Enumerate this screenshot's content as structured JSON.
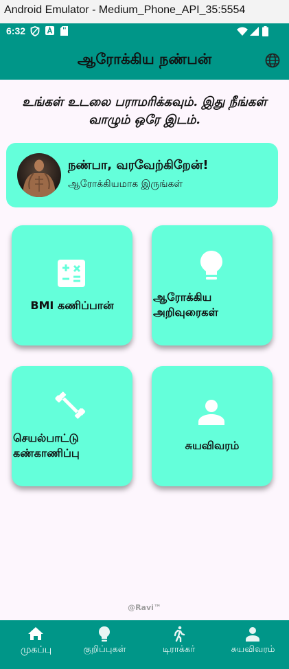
{
  "emulator": {
    "window_title": "Android Emulator - Medium_Phone_API_35:5554"
  },
  "status_bar": {
    "time": "6:32"
  },
  "app_bar": {
    "title": "ஆரோக்கிய நண்பன்",
    "action_icon": "language-globe-icon"
  },
  "tagline": "உங்கள் உடலை பராமரிக்கவும். இது நீங்கள் வாழும் ஒரே இடம்.",
  "welcome": {
    "greeting": "நண்பா, வரவேற்கிறேன்!",
    "subtitle": "ஆரோக்கியமாக இருங்கள்"
  },
  "tiles": [
    {
      "label": "BMI கணிப்பான்",
      "icon": "calculator-icon"
    },
    {
      "label": "ஆரோக்கிய அறிவுரைகள்",
      "icon": "lightbulb-icon"
    },
    {
      "label": "செயல்பாட்டு கண்காணிப்பு",
      "icon": "dumbbell-icon"
    },
    {
      "label": "சுயவிவரம்",
      "icon": "person-icon"
    }
  ],
  "footer": {
    "credit": "@Ravi™"
  },
  "bottom_nav": {
    "items": [
      {
        "label": "முகப்பு",
        "icon": "home-icon",
        "active": true
      },
      {
        "label": "குறிப்புகள்",
        "icon": "lightbulb-icon",
        "active": false
      },
      {
        "label": "டிராக்கர்",
        "icon": "walking-icon",
        "active": false
      },
      {
        "label": "சுயவிவரம்",
        "icon": "person-icon",
        "active": false
      }
    ]
  },
  "colors": {
    "primary": "#009688",
    "accent": "#64ffda",
    "background": "#fdf6fd"
  }
}
